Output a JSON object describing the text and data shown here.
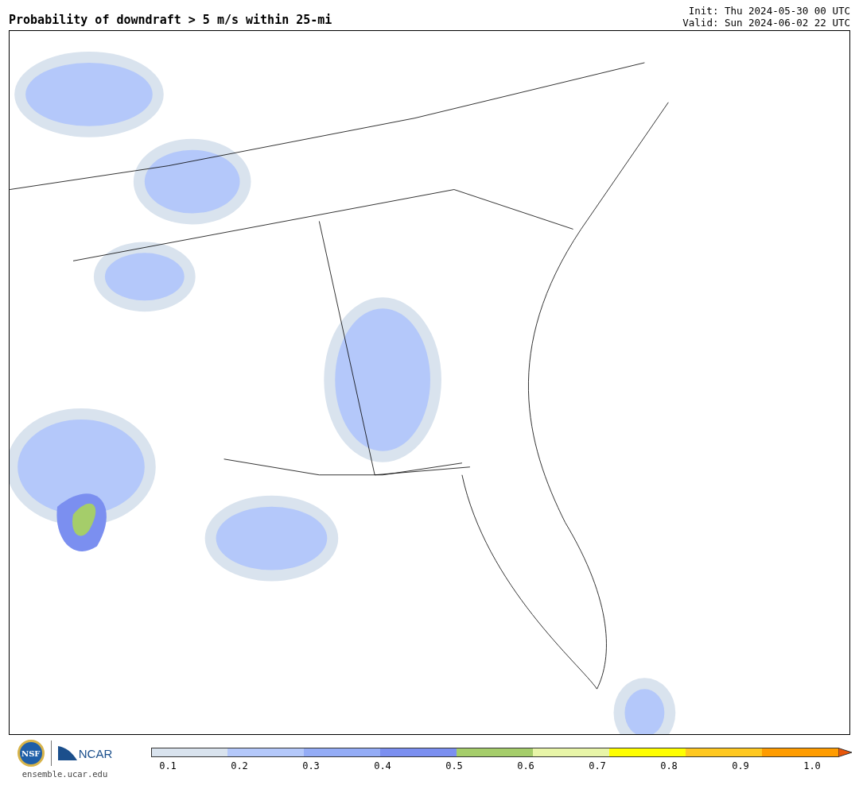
{
  "title": "Probability of downdraft > 5 m/s within 25-mi",
  "init": "Init: Thu 2024-05-30 00 UTC",
  "valid": "Valid: Sun 2024-06-02 22 UTC",
  "logos": {
    "nsf": "NSF",
    "ncar": "NCAR",
    "site": "ensemble.ucar.edu"
  },
  "colorbar": {
    "bins": [
      {
        "color": "#d9e3ee"
      },
      {
        "color": "#b4c8fa"
      },
      {
        "color": "#94acf6"
      },
      {
        "color": "#7b8ff0"
      },
      {
        "color": "#a5cd6a"
      },
      {
        "color": "#e8f5a8"
      },
      {
        "color": "#ffff00"
      },
      {
        "color": "#ffc820"
      },
      {
        "color": "#ff9c00"
      }
    ],
    "extension": {
      "color": "#e8560a"
    },
    "ticks": [
      "0.1",
      "0.2",
      "0.3",
      "0.4",
      "0.5",
      "0.6",
      "0.7",
      "0.8",
      "0.9",
      "1.0"
    ]
  }
}
